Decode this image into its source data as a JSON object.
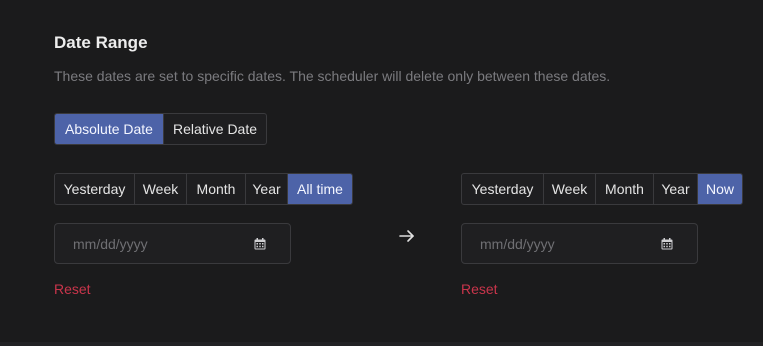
{
  "section": {
    "title": "Date Range",
    "description": "These dates are set to specific dates. The scheduler will delete only between these dates."
  },
  "mode": {
    "options": [
      "Absolute Date",
      "Relative Date"
    ],
    "selected": "Absolute Date"
  },
  "from": {
    "presets": [
      "Yesterday",
      "Week",
      "Month",
      "Year",
      "All time"
    ],
    "selected": "All time",
    "date_placeholder": "mm/dd/yyyy",
    "reset_label": "Reset"
  },
  "to": {
    "presets": [
      "Yesterday",
      "Week",
      "Month",
      "Year",
      "Now"
    ],
    "selected": "Now",
    "date_placeholder": "mm/dd/yyyy",
    "reset_label": "Reset"
  },
  "icons": {
    "arrow": "arrow-right-icon",
    "calendar": "calendar-icon"
  },
  "colors": {
    "background": "#1b1b1c",
    "accent": "#4d63a8",
    "reset": "#c9354b",
    "muted_text": "#7b7b7f"
  }
}
